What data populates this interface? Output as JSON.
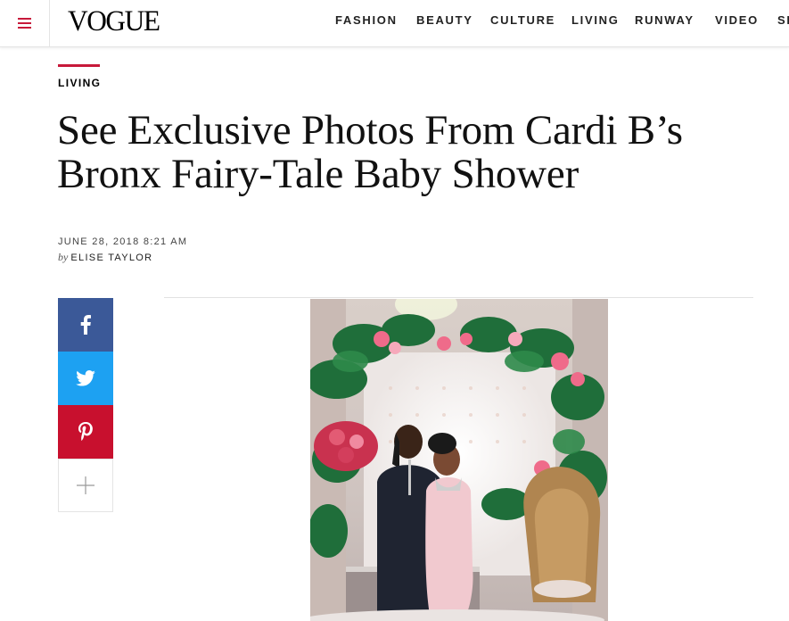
{
  "header": {
    "logo": "VOGUE",
    "nav": [
      {
        "label": "FASHION"
      },
      {
        "label": "BEAUTY"
      },
      {
        "label": "CULTURE"
      },
      {
        "label": "LIVING"
      },
      {
        "label": "RUNWAY"
      },
      {
        "label": "VIDEO"
      },
      {
        "label": "SH"
      }
    ]
  },
  "article": {
    "rubric": "LIVING",
    "title_line1": "See Exclusive Photos From Cardi B’s",
    "title_line2": "Bronx Fairy-Tale Baby Shower",
    "date": "JUNE 28, 2018 8:21 AM",
    "by": "by",
    "author": "ELISE TAYLOR"
  },
  "social": [
    {
      "network": "facebook",
      "icon": "facebook-icon",
      "color": "#3b5998"
    },
    {
      "network": "twitter",
      "icon": "twitter-icon",
      "color": "#1da1f2"
    },
    {
      "network": "pinterest",
      "icon": "pinterest-icon",
      "color": "#c8102e"
    },
    {
      "network": "more",
      "icon": "plus-icon",
      "color": "#ffffff"
    }
  ],
  "colors": {
    "accent": "#c7193a"
  }
}
